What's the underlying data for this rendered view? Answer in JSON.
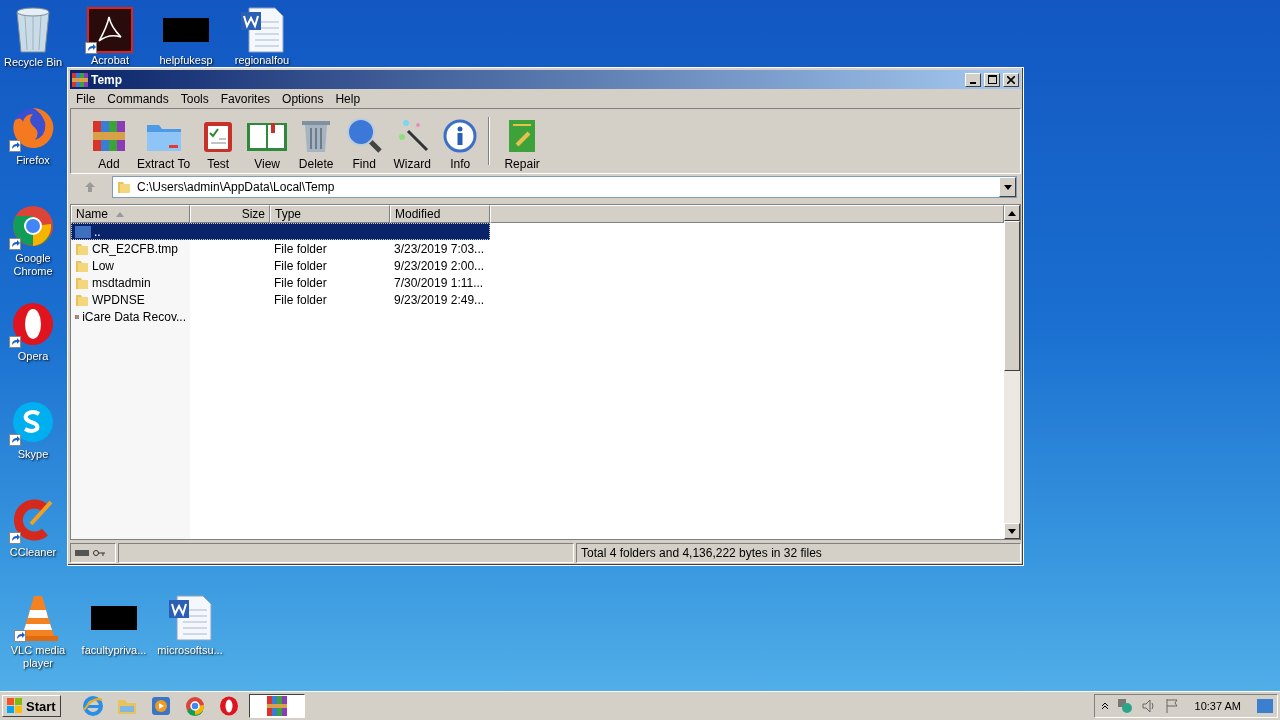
{
  "desktop": {
    "left_column": [
      {
        "label": "Recycle Bin",
        "kind": "recycle",
        "shortcut": false
      },
      {
        "label": "Firefox",
        "kind": "firefox",
        "shortcut": true
      },
      {
        "label": "Google Chrome",
        "kind": "chrome",
        "shortcut": true
      },
      {
        "label": "Opera",
        "kind": "opera",
        "shortcut": true
      },
      {
        "label": "Skype",
        "kind": "skype",
        "shortcut": true
      },
      {
        "label": "CCleaner",
        "kind": "ccleaner",
        "shortcut": true
      }
    ],
    "top_row": [
      {
        "label": "Acrobat",
        "kind": "acrobat",
        "shortcut": true
      },
      {
        "label": "helpfukesp",
        "kind": "redacted",
        "shortcut": false
      },
      {
        "label": "regionalfou",
        "kind": "word",
        "shortcut": false
      }
    ],
    "bottom_row": [
      {
        "label": "VLC media player",
        "kind": "vlc",
        "shortcut": true
      },
      {
        "label": "facultypriva...",
        "kind": "redacted",
        "shortcut": false
      },
      {
        "label": "microsoftsu...",
        "kind": "word",
        "shortcut": false
      }
    ]
  },
  "window": {
    "title": "Temp",
    "menu": [
      "File",
      "Commands",
      "Tools",
      "Favorites",
      "Options",
      "Help"
    ],
    "toolbar": [
      {
        "label": "Add",
        "kind": "add"
      },
      {
        "label": "Extract To",
        "kind": "extract"
      },
      {
        "label": "Test",
        "kind": "test"
      },
      {
        "label": "View",
        "kind": "view"
      },
      {
        "label": "Delete",
        "kind": "delete"
      },
      {
        "label": "Find",
        "kind": "find"
      },
      {
        "label": "Wizard",
        "kind": "wizard"
      },
      {
        "label": "Info",
        "kind": "info"
      },
      {
        "label": "Repair",
        "kind": "repair"
      }
    ],
    "address": "C:\\Users\\admin\\AppData\\Local\\Temp",
    "table": {
      "columns": [
        "Name",
        "Size",
        "Type",
        "Modified"
      ],
      "rows": [
        {
          "name": "..",
          "kind": "up",
          "size": "",
          "type": "",
          "modified": "",
          "selected": true
        },
        {
          "name": "CR_E2CFB.tmp",
          "kind": "folder",
          "type": "File folder",
          "modified": "3/23/2019 7:03...",
          "selected": false
        },
        {
          "name": "Low",
          "kind": "folder",
          "type": "File folder",
          "modified": "9/23/2019 2:00...",
          "selected": false
        },
        {
          "name": "msdtadmin",
          "kind": "folder",
          "type": "File folder",
          "modified": "7/30/2019 1:11...",
          "selected": false
        },
        {
          "name": "WPDNSE",
          "kind": "folder",
          "type": "File folder",
          "modified": "9/23/2019 2:49...",
          "selected": false
        },
        {
          "name": "iCare Data Recov...",
          "kind": "archive",
          "selected": false
        }
      ]
    },
    "status_bar": "Total 4 folders and 4,136,222 bytes in 32 files"
  },
  "taskbar": {
    "start": "Start",
    "apps": [
      {
        "kind": "ie",
        "selected": false
      },
      {
        "kind": "explorer",
        "selected": false
      },
      {
        "kind": "media",
        "selected": false
      },
      {
        "kind": "chrome",
        "selected": false
      },
      {
        "kind": "opera",
        "selected": false
      },
      {
        "kind": "winrar",
        "selected": true
      }
    ],
    "time": "10:37 AM"
  }
}
